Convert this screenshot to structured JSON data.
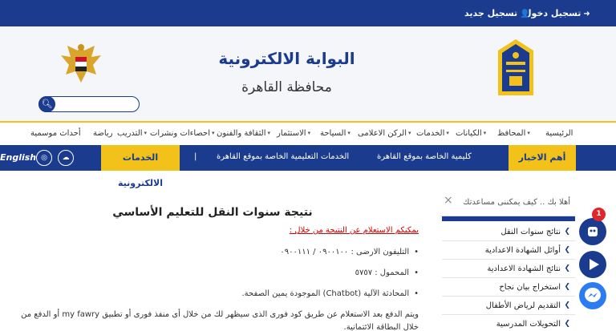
{
  "topbar": {
    "login": "تسجيل دخول",
    "register": "تسجيل جديد"
  },
  "header": {
    "title": "البوابة الالكترونية",
    "subtitle": "محافظة القاهرة",
    "search_placeholder": ""
  },
  "nav": {
    "items": [
      "الرئيسية",
      "المحافظ",
      "الكيانات",
      "الخدمات",
      "الركن الاعلامى",
      "السياحة",
      "الاستثمار",
      "الثقافة والفنون",
      "احصاءات ونشرات",
      "التدريب",
      "رياضة",
      "أحداث موسمية"
    ]
  },
  "newsbar": {
    "label": "أهم الاخبار",
    "ticker1": "كليمية الخاصة بموقع القاهرة",
    "ticker2": "الخدمات التعليمية الخاصة بموقع القاهرة",
    "separator": "|",
    "eservices": "الخدمات الالكترونية",
    "english": "English"
  },
  "content": {
    "title": "نتيجة سنوات النقل للتعليم الأساسي",
    "subtitle": "يمكنكم الاستعلام عن النتيجة من خلال :",
    "bullets": [
      "التليفون الارضى : ٠٩٠٠١٠٠ / ٠٩٠٠١١١",
      "المحمول : ٥٧٥٧",
      "المحادثة الآلية (Chatbot) الموجودة يمين الصفحة."
    ],
    "paragraph": "ويتم الدفع بعد الاستعلام عن طريق كود فورى الذى سيظهر لك من خلال أى منفذ فورى أو تطبيق my fawry أو الدفع من خلال البطاقة الائتمانية."
  },
  "chat": {
    "greeting": "أهلا بك .. كيف يمكننى مساعدتك",
    "close": "×"
  },
  "sidebar": {
    "items": [
      "نتائج سنوات النقل",
      "أوائل الشهادة الاعدادية",
      "نتائج الشهادة الاعدادية",
      "استخراج بيان نجاح",
      "التقديم لرياض الأطفال",
      "التحويلات المدرسية"
    ]
  },
  "badge": {
    "count": "1"
  },
  "colors": {
    "primary": "#1a3b8e",
    "accent": "#f2c21b",
    "alert": "#d40000"
  }
}
